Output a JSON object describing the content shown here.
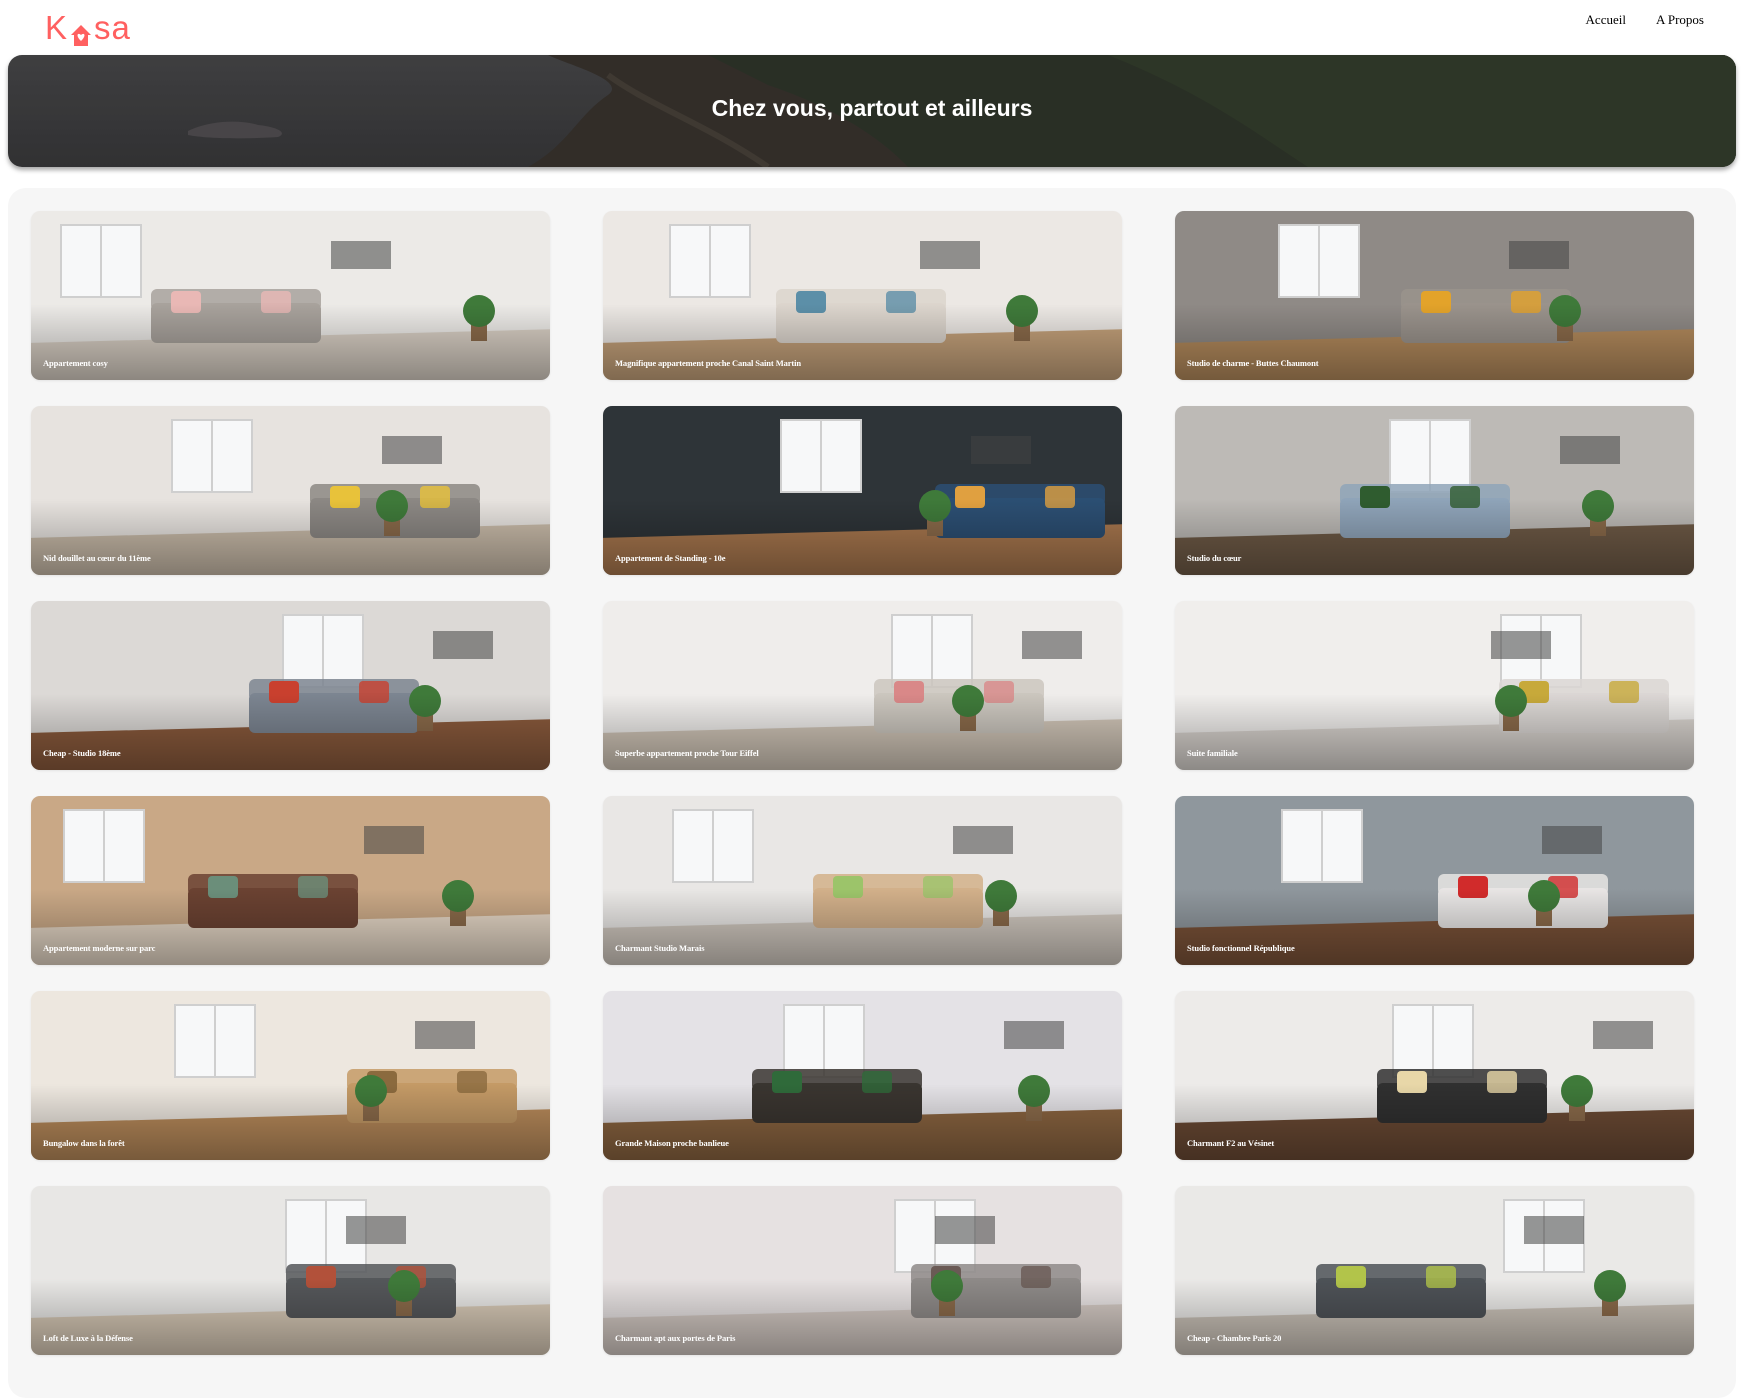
{
  "header": {
    "logo_text": "Kasa",
    "logo_color": "#FF6060",
    "nav": [
      {
        "label": "Accueil"
      },
      {
        "label": "A Propos"
      }
    ]
  },
  "banner": {
    "title": "Chez vous, partout et ailleurs"
  },
  "listings": [
    {
      "title": "Appartement cosy",
      "wall": "#ECEAE7",
      "floor": "#D8CFC4",
      "accent": "#E9B8B5",
      "sofa": "#A8A29C"
    },
    {
      "title": "Magnifique appartement proche Canal Saint Martin",
      "wall": "#ECE8E4",
      "floor": "#C4A17A",
      "accent": "#5C8FA8",
      "sofa": "#DCD5CD"
    },
    {
      "title": "Studio de charme - Buttes Chaumont",
      "wall": "#8F8A86",
      "floor": "#B38A5C",
      "accent": "#E3A32A",
      "sofa": "#9A938C"
    },
    {
      "title": "Nid douillet au cœur du 11ème",
      "wall": "#E7E3DF",
      "floor": "#C9BBA9",
      "accent": "#E8C23A",
      "sofa": "#8C8884"
    },
    {
      "title": "Appartement de Standing - 10e",
      "wall": "#2E3438",
      "floor": "#A8774E",
      "accent": "#E0A040",
      "sofa": "#2C4F73"
    },
    {
      "title": "Studio du cœur",
      "wall": "#BDBAB6",
      "floor": "#6E5A46",
      "accent": "#2F5C2F",
      "sofa": "#8FA4B9"
    },
    {
      "title": "Cheap - Studio 18ème",
      "wall": "#DCD9D6",
      "floor": "#8A5A3C",
      "accent": "#C9402E",
      "sofa": "#7C8591"
    },
    {
      "title": "Superbe appartement proche Tour Eiffel",
      "wall": "#EFEDEB",
      "floor": "#D0C5B7",
      "accent": "#D98888",
      "sofa": "#CBC6BE"
    },
    {
      "title": "Suite familiale",
      "wall": "#F0EEEC",
      "floor": "#D8D3CE",
      "accent": "#C7A93A",
      "sofa": "#DAD6D3"
    },
    {
      "title": "Appartement moderne sur parc",
      "wall": "#C9A886",
      "floor": "#E3D5C4",
      "accent": "#6B8E7A",
      "sofa": "#6B4232"
    },
    {
      "title": "Charmant Studio Marais",
      "wall": "#E9E7E5",
      "floor": "#CFC7BE",
      "accent": "#9CC46A",
      "sofa": "#D2B08A"
    },
    {
      "title": "Studio fonctionnel République",
      "wall": "#8F979D",
      "floor": "#7A5238",
      "accent": "#D12B2B",
      "sofa": "#E7E5E4"
    },
    {
      "title": "Bungalow dans la forêt",
      "wall": "#EDE7DF",
      "floor": "#B88A5A",
      "accent": "#8B6A3E",
      "sofa": "#C49A66"
    },
    {
      "title": "Grande Maison proche banlieue",
      "wall": "#E4E2E6",
      "floor": "#8A6440",
      "accent": "#2F6A3A",
      "sofa": "#3A3530"
    },
    {
      "title": "Charmant F2 au Vésinet",
      "wall": "#EDEBE9",
      "floor": "#6B4A34",
      "accent": "#E8D7A8",
      "sofa": "#303030"
    },
    {
      "title": "Loft de Luxe à la Défense",
      "wall": "#E8E7E5",
      "floor": "#D6C8B5",
      "accent": "#B2513A",
      "sofa": "#55575A"
    },
    {
      "title": "Charmant apt aux portes de Paris",
      "wall": "#E6E1E1",
      "floor": "#D2C8C2",
      "accent": "#6A5A55",
      "sofa": "#8E8A88"
    },
    {
      "title": "Cheap - Chambre Paris 20",
      "wall": "#EAE9E7",
      "floor": "#C9C1B7",
      "accent": "#B2C44A",
      "sofa": "#4E5257"
    }
  ]
}
